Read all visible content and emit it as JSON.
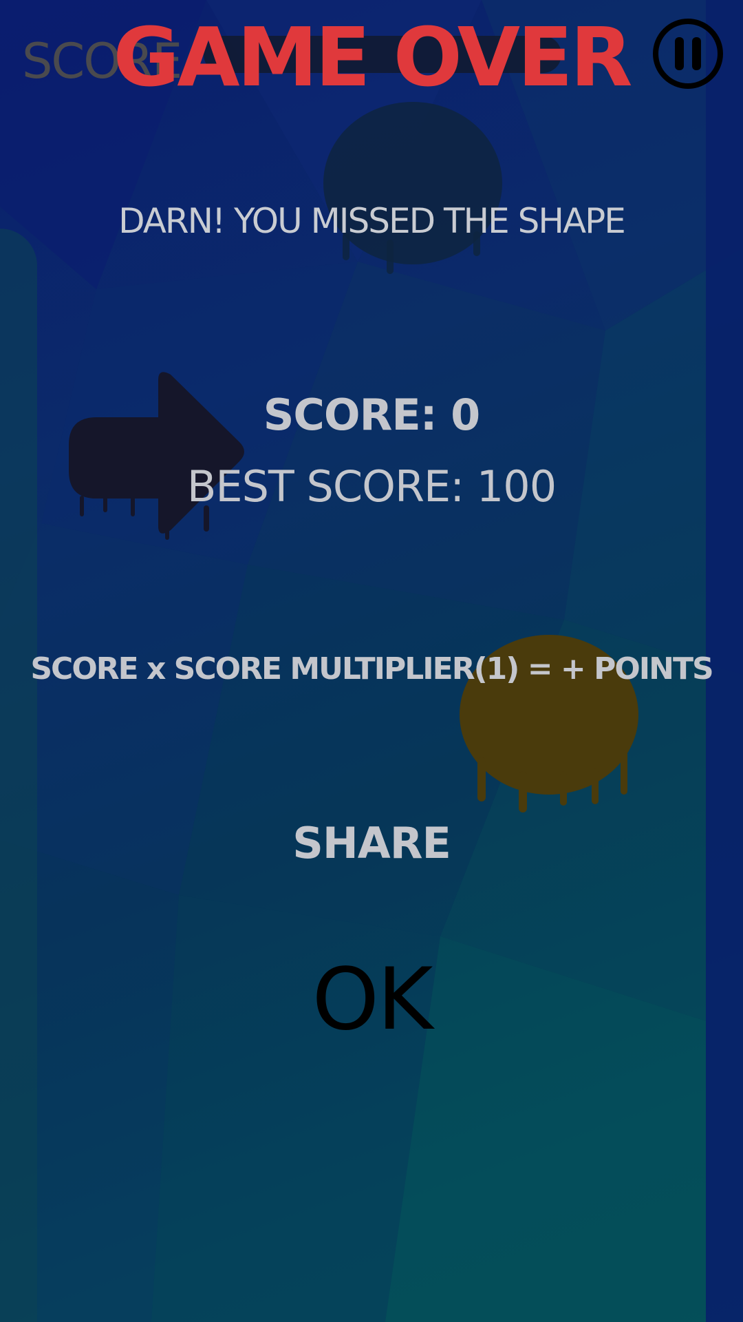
{
  "hud": {
    "score_label": "SCORE"
  },
  "game_over": {
    "title": "GAME OVER",
    "message": "DARN! YOU MISSED THE SHAPE",
    "score_text": "SCORE: 0",
    "best_score_text": "BEST SCORE: 100",
    "formula_text": "SCORE x SCORE MULTIPLIER(1) = + POINTS",
    "share_label": "SHARE",
    "ok_label": "OK"
  },
  "icons": {
    "pause": "pause-icon"
  },
  "colors": {
    "title": "#e0393c",
    "text": "#c4c6cc",
    "ok": "#000000",
    "shape_dark": "#15162a",
    "shape_gold": "#4a3b0c",
    "shape_navy": "#0e2440"
  }
}
